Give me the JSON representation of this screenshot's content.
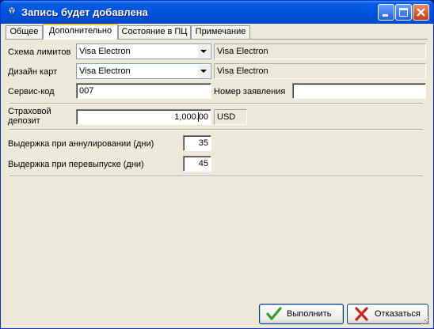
{
  "window": {
    "title": "Запись будет добавлена",
    "icon": "gem-icon",
    "controls": [
      "minimize",
      "maximize",
      "close"
    ]
  },
  "tabs": [
    {
      "label": "Общее",
      "active": false
    },
    {
      "label": "Дополнительно",
      "active": true
    },
    {
      "label": "Состояние в ПЦ",
      "active": false
    },
    {
      "label": "Примечание",
      "active": false
    }
  ],
  "form": {
    "limit_scheme": {
      "label": "Схема лимитов",
      "value": "Visa Electron",
      "readonly_value": "Visa Electron"
    },
    "card_design": {
      "label": "Дизайн карт",
      "value": "Visa Electron",
      "readonly_value": "Visa Electron"
    },
    "service_code": {
      "label": "Сервис-код",
      "value": "007"
    },
    "application_number": {
      "label": "Номер заявления",
      "value": ""
    },
    "insurance_deposit": {
      "label_line1": "Страховой",
      "label_line2": "депозит",
      "value": "1,000.00",
      "currency": "USD"
    },
    "cancel_delay": {
      "label": "Выдержка при аннулировании (дни)",
      "value": "35"
    },
    "reissue_delay": {
      "label": "Выдержка при перевыпуске (дни)",
      "value": "45"
    }
  },
  "buttons": {
    "execute": "Выполнить",
    "cancel": "Отказаться"
  },
  "colors": {
    "titlebar": "#0054e3",
    "dialog_bg": "#ece9d8",
    "tab_active_accent": "#ffc83c",
    "ok_icon": "#2e9e2e",
    "cancel_icon": "#c0281e"
  }
}
